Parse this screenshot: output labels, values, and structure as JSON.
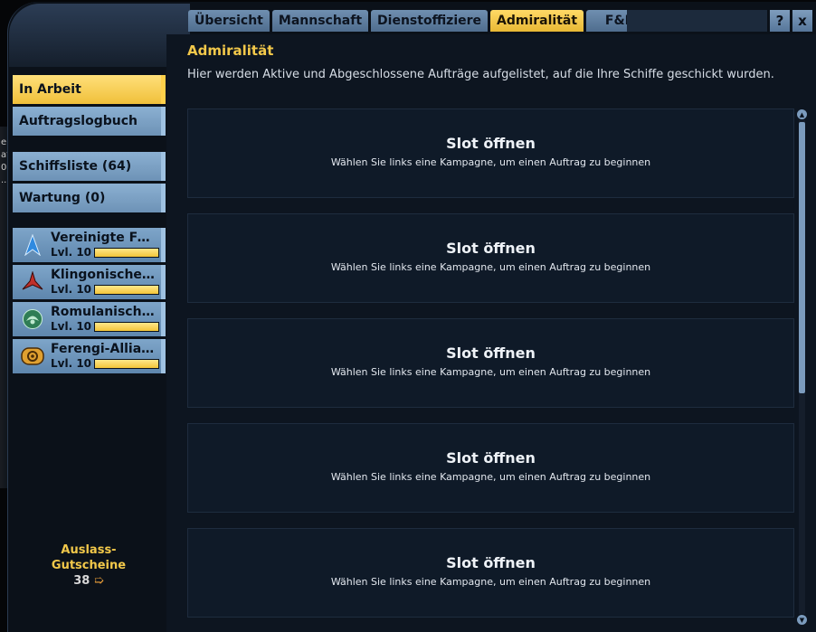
{
  "tabs": [
    {
      "label": "Übersicht",
      "active": false
    },
    {
      "label": "Mannschaft",
      "active": false
    },
    {
      "label": "Dienstoffiziere",
      "active": false
    },
    {
      "label": "Admiralität",
      "active": true
    },
    {
      "label": "F&E",
      "active": false
    }
  ],
  "window_buttons": {
    "help": "?",
    "close": "x"
  },
  "edge_fragments": [
    "e",
    "at",
    "0",
    "..."
  ],
  "sidebar": {
    "items": [
      {
        "label": "In Arbeit",
        "active": true
      },
      {
        "label": "Auftragslogbuch",
        "active": false
      },
      {
        "label": "Schiffsliste (64)",
        "active": false
      },
      {
        "label": "Wartung (0)",
        "active": false
      }
    ],
    "factions": [
      {
        "name": "Vereinigte Föderation",
        "level": "Lvl. 10",
        "progress": 1.0,
        "icon": "starfleet-delta-icon",
        "color": "#3a8fe0"
      },
      {
        "name": "Klingonisches Reich",
        "level": "Lvl. 10",
        "progress": 1.0,
        "icon": "klingon-trefoil-icon",
        "color": "#c0302a"
      },
      {
        "name": "Romulanisches Sternenimperium",
        "level": "Lvl. 10",
        "progress": 1.0,
        "icon": "romulan-emblem-icon",
        "color": "#3e9a6a"
      },
      {
        "name": "Ferengi-Allianz",
        "level": "Lvl. 10",
        "progress": 1.0,
        "icon": "ferengi-emblem-icon",
        "color": "#e0a030"
      }
    ],
    "vouchers": {
      "label_line1": "Auslass-",
      "label_line2": "Gutscheine",
      "count": "38",
      "icon": "voucher-arrow-icon"
    }
  },
  "main": {
    "title": "Admiralität",
    "description": "Hier werden Aktive und Abgeschlossene Aufträge aufgelistet, auf die Ihre Schiffe geschickt wurden.",
    "slots": [
      {
        "title": "Slot öffnen",
        "subtitle": "Wählen Sie links eine Kampagne, um einen Auftrag zu beginnen"
      },
      {
        "title": "Slot öffnen",
        "subtitle": "Wählen Sie links eine Kampagne, um einen Auftrag zu beginnen"
      },
      {
        "title": "Slot öffnen",
        "subtitle": "Wählen Sie links eine Kampagne, um einen Auftrag zu beginnen"
      },
      {
        "title": "Slot öffnen",
        "subtitle": "Wählen Sie links eine Kampagne, um einen Auftrag zu beginnen"
      },
      {
        "title": "Slot öffnen",
        "subtitle": "Wählen Sie links eine Kampagne, um einen Auftrag zu beginnen"
      }
    ]
  },
  "colors": {
    "accent": "#f2c84a",
    "tab": "#6f8fb0",
    "panel": "#0d1520"
  }
}
